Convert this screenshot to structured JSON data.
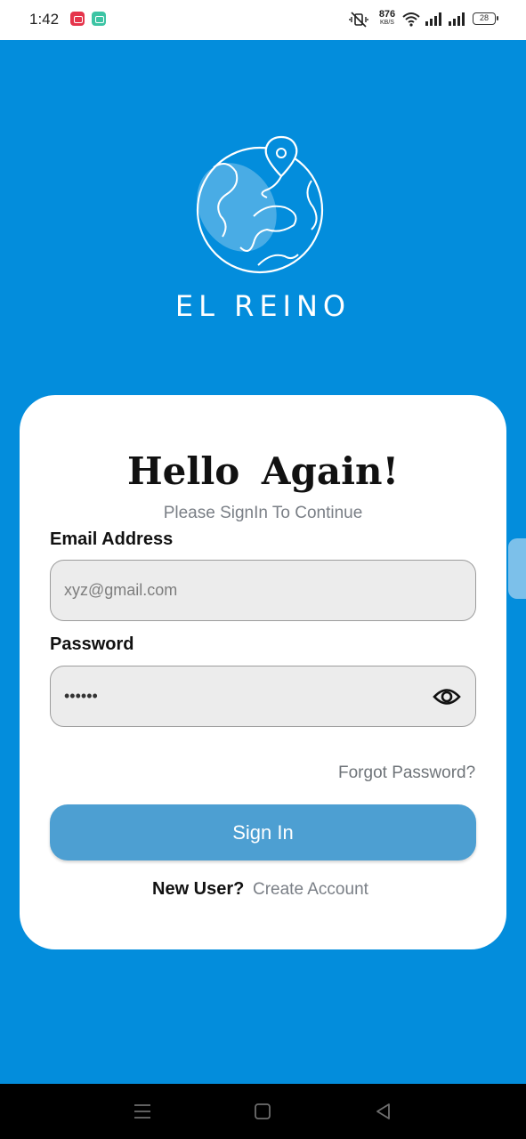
{
  "status_bar": {
    "time": "1:42",
    "net_speed_value": "876",
    "net_speed_unit": "KB/S",
    "battery": "28",
    "icons": [
      "video-notification-icon",
      "message-notification-icon",
      "mute-vibrate-icon",
      "wifi-icon",
      "signal-icon",
      "signal-icon",
      "battery-icon"
    ]
  },
  "brand": {
    "name": "EL REINO",
    "logo_icon": "globe-location-pin-icon"
  },
  "login": {
    "title": "Hello  Again!",
    "subtitle": "Please SignIn To Continue",
    "email_label": "Email Address",
    "email_placeholder": "xyz@gmail.com",
    "password_label": "Password",
    "password_value": "******",
    "forgot_password": "Forgot Password?",
    "signin_button": "Sign In",
    "new_user_label": "New User?",
    "create_account": "Create Account"
  },
  "colors": {
    "background": "#038ddc",
    "card": "#ffffff",
    "button": "#4d9fd2",
    "input_fill": "#ececec"
  }
}
